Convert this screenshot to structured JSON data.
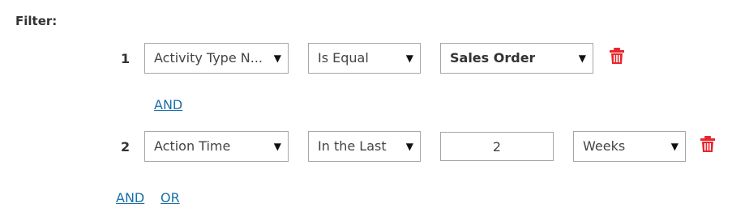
{
  "filter": {
    "title": "Filter:"
  },
  "rows": [
    {
      "number": "1",
      "field": "Activity Type N...",
      "operator": "Is Equal",
      "value": "Sales Order"
    },
    {
      "number": "2",
      "field": "Action Time",
      "operator": "In the Last",
      "amount": "2",
      "unit": "Weeks"
    }
  ],
  "links": {
    "and_between": "AND",
    "and_bottom": "AND",
    "or_bottom": "OR"
  },
  "icons": {
    "dropdown_arrow": "▼",
    "delete": "trash-icon"
  },
  "colors": {
    "delete": "#e8262d",
    "link": "#1a6fa8",
    "border": "#a6a6a6"
  }
}
